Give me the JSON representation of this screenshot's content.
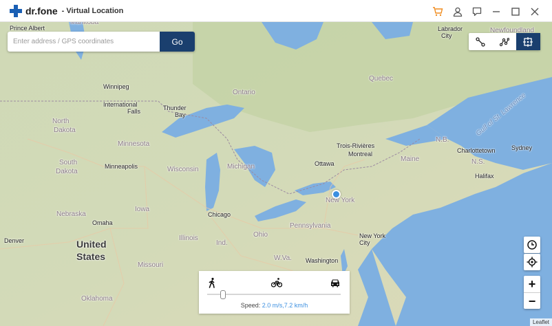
{
  "app": {
    "brand": "dr.fone",
    "title": "- Virtual Location"
  },
  "titlebar_icons": [
    "cart-icon",
    "user-icon",
    "feedback-icon",
    "minimize-icon",
    "maximize-icon",
    "close-icon"
  ],
  "search": {
    "placeholder": "Enter address / GPS coordinates",
    "value": "",
    "go_label": "Go"
  },
  "mode_buttons": [
    {
      "name": "one-stop-route-icon",
      "active": false
    },
    {
      "name": "multi-stop-route-icon",
      "active": false
    },
    {
      "name": "teleport-mode-icon",
      "active": true
    }
  ],
  "map_labels": [
    {
      "text": "Prince Albert",
      "type": "city"
    },
    {
      "text": "Manitoba",
      "type": "region"
    },
    {
      "text": "Labrador",
      "type": "city"
    },
    {
      "text": "City",
      "type": "city"
    },
    {
      "text": "Newfoundland",
      "type": "region"
    },
    {
      "text": "Winnipeg",
      "type": "city"
    },
    {
      "text": "Ontario",
      "type": "region"
    },
    {
      "text": "Quebec",
      "type": "region"
    },
    {
      "text": "International",
      "type": "city"
    },
    {
      "text": "Falls",
      "type": "city"
    },
    {
      "text": "Thunder",
      "type": "city"
    },
    {
      "text": "Bay",
      "type": "city"
    },
    {
      "text": "North",
      "type": "region"
    },
    {
      "text": "Dakota",
      "type": "region"
    },
    {
      "text": "Minnesota",
      "type": "region"
    },
    {
      "text": "Trois-Rivières",
      "type": "city"
    },
    {
      "text": "N.B.",
      "type": "region"
    },
    {
      "text": "Charlottetown",
      "type": "city"
    },
    {
      "text": "Sydney",
      "type": "city"
    },
    {
      "text": "South",
      "type": "region"
    },
    {
      "text": "Dakota",
      "type": "region"
    },
    {
      "text": "Minneapolis",
      "type": "city"
    },
    {
      "text": "Wisconsin",
      "type": "region"
    },
    {
      "text": "Ottawa",
      "type": "city"
    },
    {
      "text": "Montreal",
      "type": "city"
    },
    {
      "text": "Maine",
      "type": "region"
    },
    {
      "text": "N.S.",
      "type": "region"
    },
    {
      "text": "Halifax",
      "type": "city"
    },
    {
      "text": "Michigan",
      "type": "region"
    },
    {
      "text": "Iowa",
      "type": "region"
    },
    {
      "text": "Nebraska",
      "type": "region"
    },
    {
      "text": "Chicago",
      "type": "city"
    },
    {
      "text": "New York",
      "type": "region"
    },
    {
      "text": "Omaha",
      "type": "city"
    },
    {
      "text": "Pennsylvania",
      "type": "region"
    },
    {
      "text": "Denver",
      "type": "city"
    },
    {
      "text": "United",
      "type": "country"
    },
    {
      "text": "States",
      "type": "country"
    },
    {
      "text": "Illinois",
      "type": "region"
    },
    {
      "text": "Ind.",
      "type": "region"
    },
    {
      "text": "Ohio",
      "type": "region"
    },
    {
      "text": "New York",
      "type": "city"
    },
    {
      "text": "City",
      "type": "city"
    },
    {
      "text": "W.Va.",
      "type": "region"
    },
    {
      "text": "Washington",
      "type": "city"
    },
    {
      "text": "Missouri",
      "type": "region"
    },
    {
      "text": "Oklahoma",
      "type": "region"
    },
    {
      "text": "Gulf of St. Lawrence",
      "type": "water"
    }
  ],
  "speed": {
    "label": "Speed:",
    "value": "2.0 m/s,7.2 km/h",
    "level": 0.12,
    "modes": [
      "walk-icon",
      "bike-icon",
      "car-icon"
    ]
  },
  "attribution": "Leaflet"
}
